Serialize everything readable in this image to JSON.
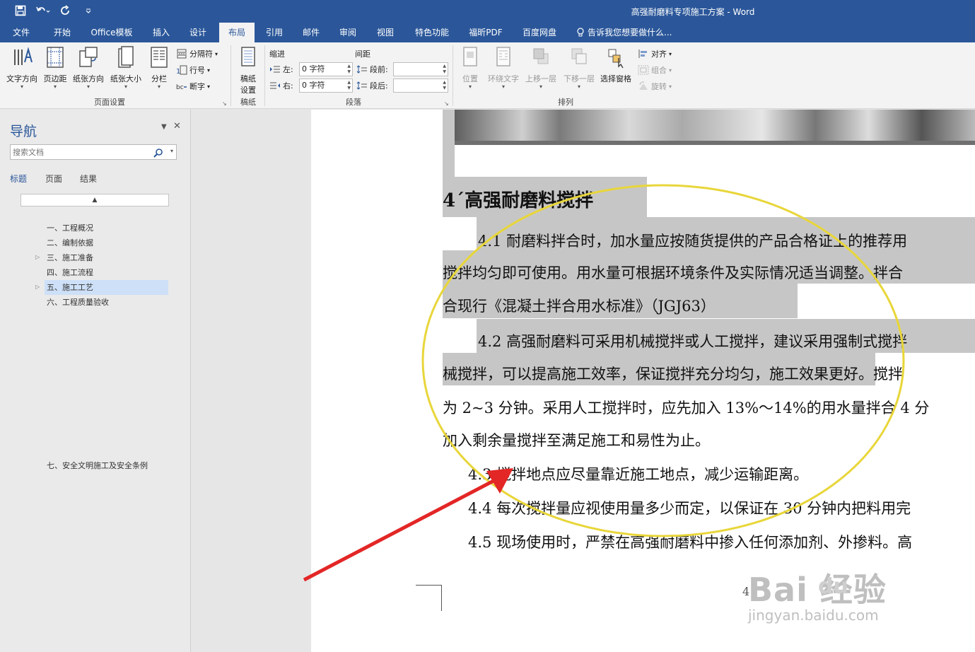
{
  "window": {
    "title": "高强耐磨料专项施工方案 - Word"
  },
  "ribbon_tabs": [
    "文件",
    "开始",
    "Office模板",
    "插入",
    "设计",
    "布局",
    "引用",
    "邮件",
    "审阅",
    "视图",
    "特色功能",
    "福昕PDF",
    "百度网盘"
  ],
  "active_tab": "布局",
  "tell_me": "告诉我您想要做什么...",
  "ribbon": {
    "page_setup": {
      "text_direction": "文字方向",
      "margins": "页边距",
      "orientation": "纸张方向",
      "size": "纸张大小",
      "columns": "分栏",
      "breaks": "分隔符",
      "line_numbers": "行号",
      "hyphenation": "断字",
      "label": "页面设置"
    },
    "draft": {
      "draft_settings_line1": "稿纸",
      "draft_settings_line2": "设置",
      "label": "稿纸"
    },
    "paragraph": {
      "indent_header": "缩进",
      "spacing_header": "间距",
      "left_label": "左:",
      "left_value": "0 字符",
      "right_label": "右:",
      "right_value": "0 字符",
      "before_label": "段前:",
      "after_label": "段后:",
      "label": "段落"
    },
    "arrange": {
      "position": "位置",
      "wrap_text": "环绕文字",
      "bring_forward": "上移一层",
      "send_backward": "下移一层",
      "selection_pane": "选择窗格",
      "align": "对齐",
      "group": "组合",
      "rotate": "旋转",
      "label": "排列"
    }
  },
  "navigation": {
    "title": "导航",
    "search_placeholder": "搜索文档",
    "tabs": [
      "标题",
      "页面",
      "结果"
    ],
    "headings": [
      "一、工程概况",
      "二、编制依据",
      "三、施工准备",
      "四、施工流程",
      "五、施工工艺",
      "六、工程质量验收",
      "七、安全文明施工及安全条例"
    ],
    "selected_heading": "五、施工工艺"
  },
  "document": {
    "heading": "4´高强耐磨料搅拌",
    "lines": [
      "4.1 耐磨料拌合时，加水量应按随货提供的产品合格证上的推荐用",
      "搅拌均匀即可使用。用水量可根据环境条件及实际情况适当调整。拌合",
      "合现行《混凝土拌合用水标准》（JGJ63）",
      "4.2 高强耐磨料可采用机械搅拌或人工搅拌，建议采用强制式搅拌",
      "械搅拌，可以提高施工效率，保证搅拌充分均匀，施工效果更好。搅拌",
      "为 2~3 分钟。采用人工搅拌时，应先加入 13%～14%的用水量拌合 4 分",
      "加入剩余量搅拌至满足施工和易性为止。",
      "4.3 搅拌地点应尽量靠近施工地点，减少运输距离。",
      "4.4 每次搅拌量应视使用量多少而定，以保证在 30 分钟内把料用完",
      "4.5 现场使用时，严禁在高强耐磨料中掺入任何添加剂、外掺料。高"
    ],
    "page_number_fragment": "4"
  },
  "watermark": {
    "brand": "Bai  经验",
    "brand_du": "du",
    "url": "jingyan.baidu.com"
  },
  "colors": {
    "brand_blue": "#2b579a",
    "annotation_ellipse": "#e8d63a",
    "annotation_arrow": "#e32626",
    "selection_highlight": "#c6c6c6",
    "nav_selected": "#cde0f7"
  }
}
